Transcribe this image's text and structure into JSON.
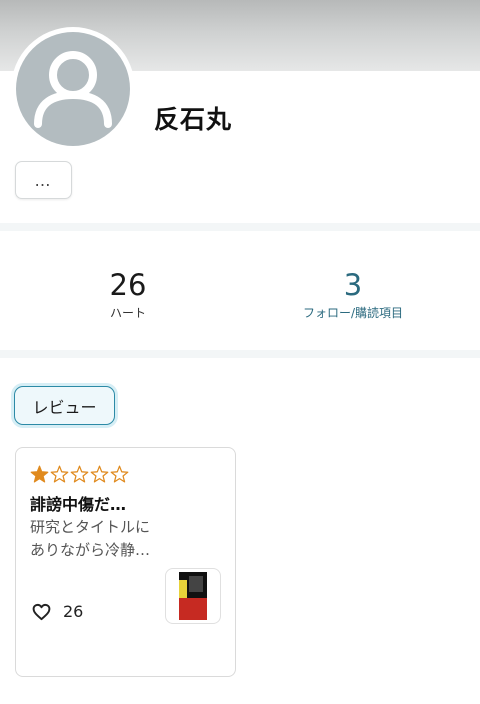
{
  "profile": {
    "username": "反石丸",
    "more_label": "…"
  },
  "stats": {
    "hearts_count": "26",
    "hearts_label": "ハート",
    "follow_count": "3",
    "follow_label": "フォロー/購読項目"
  },
  "tabs": {
    "reviews_label": "レビュー"
  },
  "reviews": [
    {
      "rating": 1,
      "rating_max": 5,
      "title": "誹謗中傷だ…",
      "body_line1": "研究とタイトルに",
      "body_line2": "ありながら冷静…",
      "likes": "26",
      "star_color": "#e08a1e",
      "thumbnail_icon": "book-cover-icon"
    }
  ],
  "colors": {
    "accent": "#2b6a7f",
    "tab_border": "#2c8aa6",
    "avatar_bg": "#b3bcc0"
  }
}
